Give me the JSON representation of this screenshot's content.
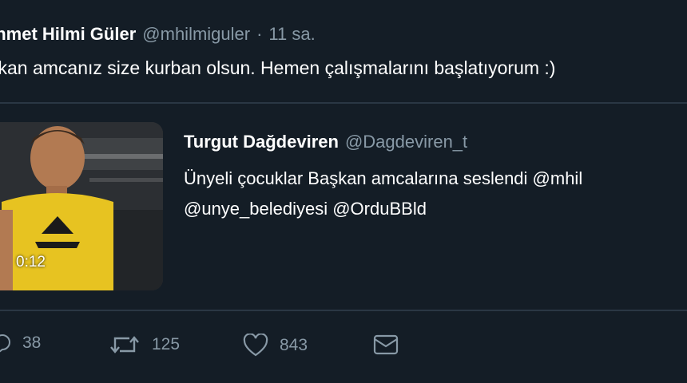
{
  "tweet": {
    "author_name": "ehmet Hilmi Güler",
    "author_handle": "@mhilmiguler",
    "separator": "·",
    "time": "11 sa.",
    "text": "şkan amcanız size kurban olsun. Hemen çalışmalarını başlatıyorum :)"
  },
  "quoted": {
    "author_name": "Turgut Dağdeviren",
    "author_handle": "@Dagdeviren_t",
    "text_line1": "Ünyeli çocuklar Başkan amcalarına seslendi @mhil",
    "text_line2": "@unye_belediyesi @OrduBBld",
    "video_duration": "0:12"
  },
  "actions": {
    "replies": "38",
    "retweets": "125",
    "likes": "843"
  },
  "colors": {
    "background": "#141d26",
    "secondary_text": "#8899a6",
    "divider": "#2a3744"
  }
}
